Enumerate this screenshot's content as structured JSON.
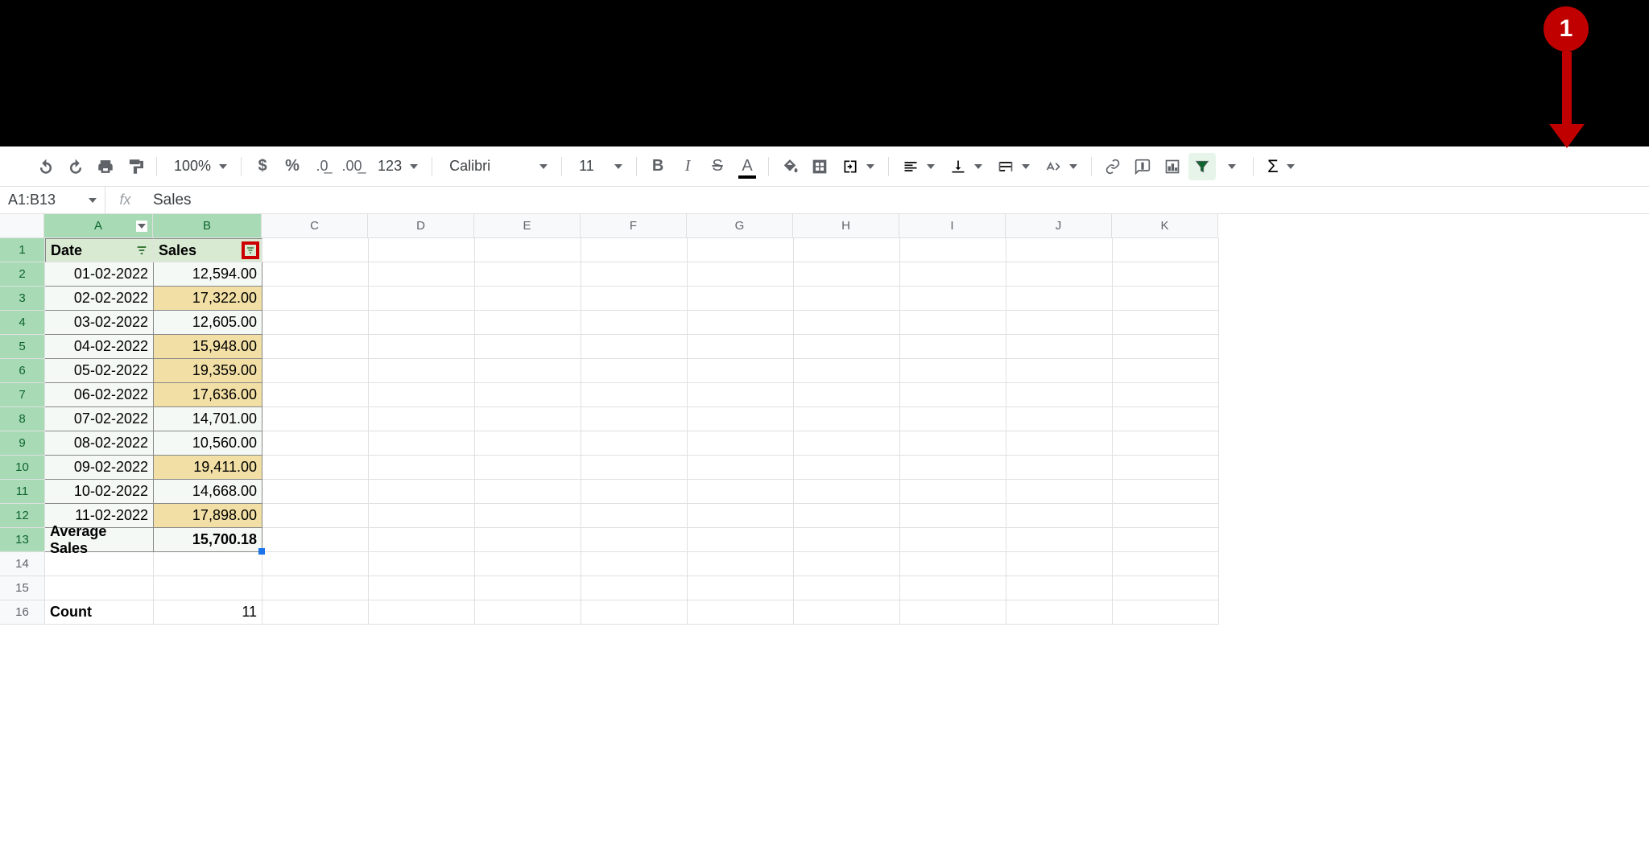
{
  "annotation": {
    "badge": "1"
  },
  "toolbar": {
    "zoom": "100%",
    "format_menu": "123",
    "font": "Calibri",
    "font_size": "11"
  },
  "namebox": "A1:B13",
  "fx": "fx",
  "formula_value": "Sales",
  "columns": [
    "A",
    "B",
    "C",
    "D",
    "E",
    "F",
    "G",
    "H",
    "I",
    "J",
    "K"
  ],
  "rows": [
    "1",
    "2",
    "3",
    "4",
    "5",
    "6",
    "7",
    "8",
    "9",
    "10",
    "11",
    "12",
    "13",
    "14",
    "15",
    "16"
  ],
  "table": {
    "headers": [
      "Date",
      "Sales"
    ],
    "data": [
      {
        "date": "01-02-2022",
        "sales": "12,594.00",
        "highlight": false
      },
      {
        "date": "02-02-2022",
        "sales": "17,322.00",
        "highlight": true
      },
      {
        "date": "03-02-2022",
        "sales": "12,605.00",
        "highlight": false
      },
      {
        "date": "04-02-2022",
        "sales": "15,948.00",
        "highlight": true
      },
      {
        "date": "05-02-2022",
        "sales": "19,359.00",
        "highlight": true
      },
      {
        "date": "06-02-2022",
        "sales": "17,636.00",
        "highlight": true
      },
      {
        "date": "07-02-2022",
        "sales": "14,701.00",
        "highlight": false
      },
      {
        "date": "08-02-2022",
        "sales": "10,560.00",
        "highlight": false
      },
      {
        "date": "09-02-2022",
        "sales": "19,411.00",
        "highlight": true
      },
      {
        "date": "10-02-2022",
        "sales": "14,668.00",
        "highlight": false
      },
      {
        "date": "11-02-2022",
        "sales": "17,898.00",
        "highlight": true
      }
    ],
    "footer_label": "Average Sales",
    "footer_value": "15,700.18",
    "count_label": "Count",
    "count_value": "11"
  }
}
